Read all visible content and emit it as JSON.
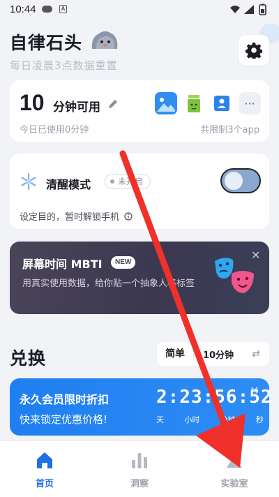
{
  "status_bar": {
    "time": "10:44",
    "a_badge": "A"
  },
  "header": {
    "title": "自律石头",
    "subtitle": "每日凌晨3点数据重置"
  },
  "usage": {
    "minutes": "10",
    "unit_label": "分钟可用",
    "used_today": "今日已使用0分钟",
    "limit_text": "共限制3个app",
    "more_label": "···",
    "apps": [
      "gallery-app-icon",
      "trash-app-icon",
      "contacts-app-icon"
    ]
  },
  "wake_mode": {
    "title": "清醒模式",
    "status": "未开启",
    "description": "设定目的，暂时解锁手机",
    "enabled": false
  },
  "mbti": {
    "title": "屏幕时间 MBTI",
    "badge": "NEW",
    "description": "用真实使用数据，给你贴一个抽象人格标签",
    "close": "✕"
  },
  "exchange": {
    "title": "兑换",
    "difficulty": "简单",
    "duration": "10分钟",
    "sort_icon": "⇄"
  },
  "promo": {
    "title": "永久会员限时折扣",
    "subtitle": "快来锁定优惠价格!",
    "countdown": "2:23:56:52",
    "labels": [
      "天",
      "小时",
      "分钟",
      "秒"
    ],
    "close": "✕"
  },
  "tabs": [
    {
      "label": "首页",
      "icon": "home-icon",
      "active": true
    },
    {
      "label": "洞察",
      "icon": "bar-chart-icon",
      "active": false
    },
    {
      "label": "实验室",
      "icon": "flask-icon",
      "active": false
    }
  ],
  "colors": {
    "accent": "#1e6fe8",
    "promo": "#1f7ff0",
    "mbti_bg": "#3c3850",
    "annotation_arrow": "#f0302a"
  }
}
